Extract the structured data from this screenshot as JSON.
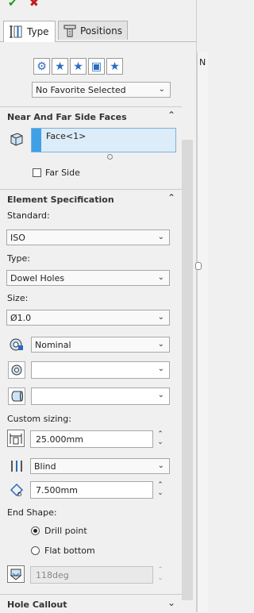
{
  "toolbar": {
    "ok_glyph": "✔",
    "cancel_glyph": "✖"
  },
  "tabs": [
    {
      "label": "Type"
    },
    {
      "label": "Positions"
    }
  ],
  "favorites": {
    "selected": "No Favorite Selected"
  },
  "near_far": {
    "title": "Near And Far Side Faces",
    "selection": "Face<1>",
    "far_side_label": "Far Side"
  },
  "element_spec": {
    "title": "Element Specification",
    "standard_label": "Standard:",
    "standard_value": "ISO",
    "type_label": "Type:",
    "type_value": "Dowel Holes",
    "size_label": "Size:",
    "size_value": "Ø1.0",
    "fit_value": "Nominal"
  },
  "custom_sizing": {
    "label": "Custom sizing:",
    "diameter": "25.000mm",
    "end_condition": "Blind",
    "depth": "7.500mm"
  },
  "end_shape": {
    "label": "End Shape:",
    "drill_point_label": "Drill point",
    "flat_bottom_label": "Flat bottom",
    "angle_value": "118deg"
  },
  "hole_callout": {
    "title": "Hole Callout"
  },
  "right_panel": {
    "letter": "N"
  }
}
